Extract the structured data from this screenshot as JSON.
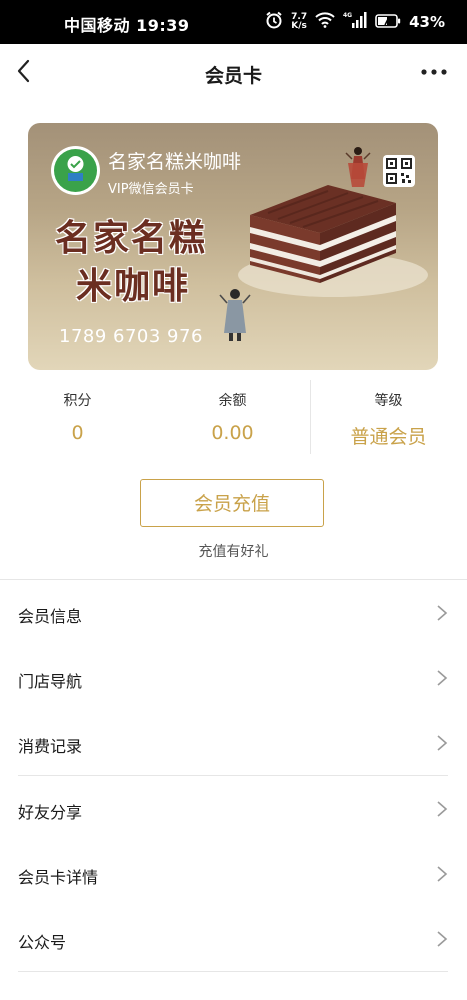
{
  "status_bar": {
    "carrier_time": "中国移动 19:39",
    "net_speed_value": "7.7",
    "net_speed_unit": "K/s",
    "signal_tag": "4G",
    "battery": "43%"
  },
  "nav": {
    "title": "会员卡"
  },
  "card": {
    "store_name": "名家名糕米咖啡",
    "card_type": "VIP微信会员卡",
    "brand_line1": "名家名糕",
    "brand_line2": "米咖啡",
    "card_number": "1789 6703 976",
    "logo_caption": "名家名糕"
  },
  "stats": [
    {
      "label": "积分",
      "value": "0"
    },
    {
      "label": "余额",
      "value": "0.00"
    },
    {
      "label": "等级",
      "value": "普通会员"
    }
  ],
  "recharge": {
    "button_label": "会员充值",
    "hint": "充值有好礼"
  },
  "menu": [
    {
      "label": "会员信息"
    },
    {
      "label": "门店导航"
    },
    {
      "label": "消费记录"
    },
    {
      "label": "好友分享"
    },
    {
      "label": "会员卡详情"
    },
    {
      "label": "公众号"
    }
  ],
  "colors": {
    "accent_gold": "#c9a24a",
    "brand_brown": "#6b2e21",
    "logo_green": "#3aa24a"
  }
}
